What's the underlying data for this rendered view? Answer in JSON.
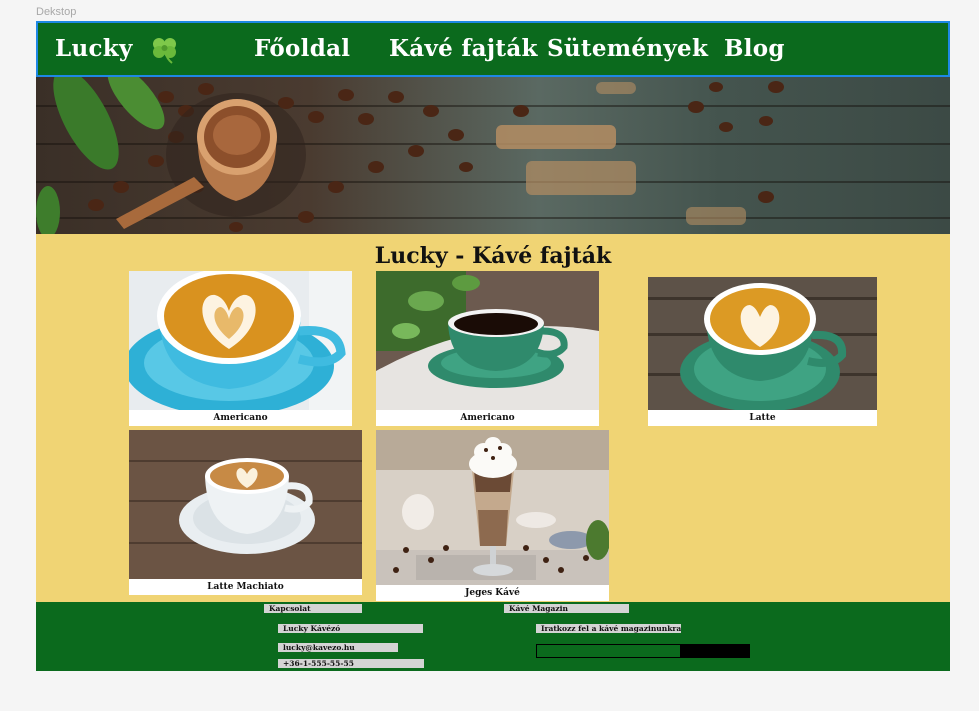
{
  "frame_label": "Dekstop",
  "nav": {
    "brand": "Lucky",
    "logo_icon": "shamrock-icon",
    "items": [
      {
        "label": "Főoldal"
      },
      {
        "label": "Kávé fajták"
      },
      {
        "label": "Sütemények"
      },
      {
        "label": "Blog"
      }
    ]
  },
  "main": {
    "title": "Lucky - Kávé fajták",
    "cards": [
      {
        "caption": "Americano"
      },
      {
        "caption": "Americano"
      },
      {
        "caption": "Latte"
      },
      {
        "caption": "Latte Machiato"
      },
      {
        "caption": "Jeges Kávé"
      }
    ]
  },
  "footer": {
    "contact_heading": "Kapcsolat",
    "contact_name": "Lucky Kávézó",
    "contact_email": "lucky@kavezo.hu",
    "contact_phone": "+36-1-555-55-55",
    "magazine_heading": "Kávé Magazin",
    "magazine_text": "Iratkozz fel a kávé magazinunkra"
  },
  "colors": {
    "nav_bg": "#0b6a1d",
    "content_bg": "#f0d474",
    "footer_bg": "#0b6a1d",
    "selection_outline": "#1e88e5"
  }
}
